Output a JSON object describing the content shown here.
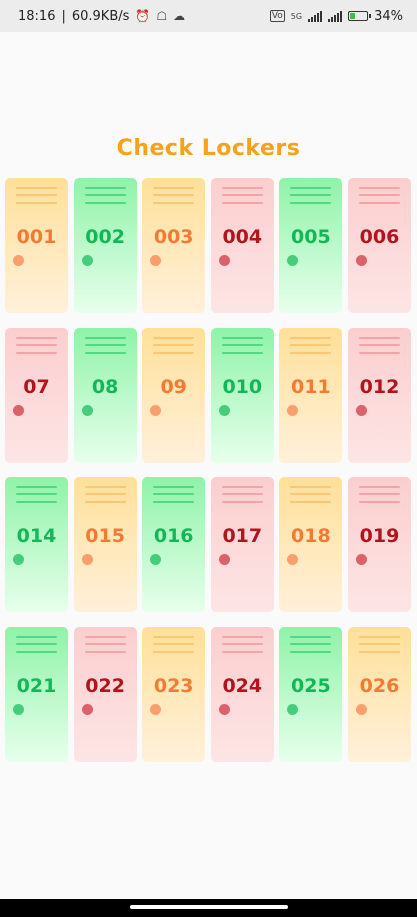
{
  "status_bar": {
    "time": "18:16",
    "speed": "60.9KB/s",
    "network_label": "5G",
    "battery_percent": "34%",
    "battery_level": 0.34
  },
  "title": "Check Lockers",
  "colors": {
    "available": "#12b857",
    "occupied": "#b3131d",
    "pending": "#f47a33"
  },
  "lockers": [
    {
      "number": "001",
      "status": "yellow"
    },
    {
      "number": "002",
      "status": "green"
    },
    {
      "number": "003",
      "status": "yellow"
    },
    {
      "number": "004",
      "status": "red"
    },
    {
      "number": "005",
      "status": "green"
    },
    {
      "number": "006",
      "status": "red"
    },
    {
      "number": "07",
      "status": "red"
    },
    {
      "number": "08",
      "status": "green"
    },
    {
      "number": "09",
      "status": "yellow"
    },
    {
      "number": "010",
      "status": "green"
    },
    {
      "number": "011",
      "status": "yellow"
    },
    {
      "number": "012",
      "status": "red"
    },
    {
      "number": "014",
      "status": "green"
    },
    {
      "number": "015",
      "status": "yellow"
    },
    {
      "number": "016",
      "status": "green"
    },
    {
      "number": "017",
      "status": "red"
    },
    {
      "number": "018",
      "status": "yellow"
    },
    {
      "number": "019",
      "status": "red"
    },
    {
      "number": "021",
      "status": "green"
    },
    {
      "number": "022",
      "status": "red"
    },
    {
      "number": "023",
      "status": "yellow"
    },
    {
      "number": "024",
      "status": "red"
    },
    {
      "number": "025",
      "status": "green"
    },
    {
      "number": "026",
      "status": "yellow"
    }
  ]
}
